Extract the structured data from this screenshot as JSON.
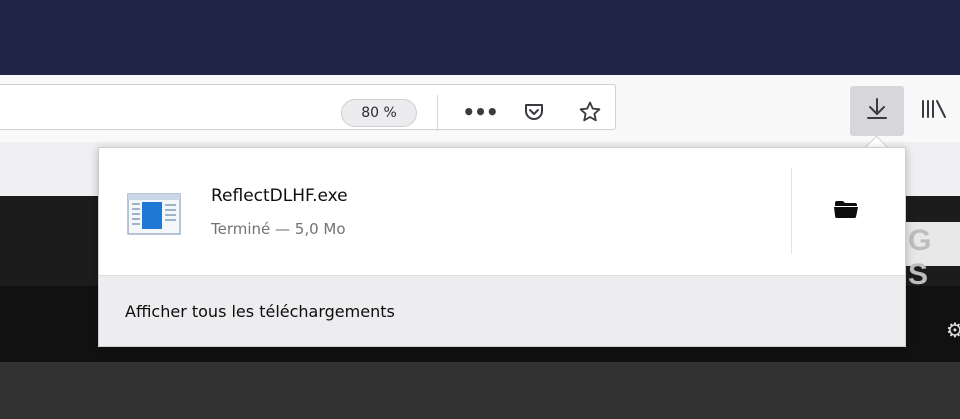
{
  "toolbar": {
    "zoom_level": "80 %",
    "icons": [
      "more-actions-icon",
      "pocket-icon",
      "bookmark-star-icon",
      "download-icon",
      "library-icon"
    ]
  },
  "page_behind": {
    "peek_text": "G S"
  },
  "downloads_panel": {
    "items": [
      {
        "file_name": "ReflectDLHF.exe",
        "status": "Terminé — 5,0 Mo",
        "icon": "exe-file-icon",
        "action_icon": "open-folder-icon"
      }
    ],
    "footer_label": "Afficher tous les téléchargements"
  },
  "colors": {
    "titlebar": "#212545",
    "toolbar": "#f9f9fa",
    "panel_footer": "#ededf0",
    "file_icon_blue": "#1e78d6"
  }
}
